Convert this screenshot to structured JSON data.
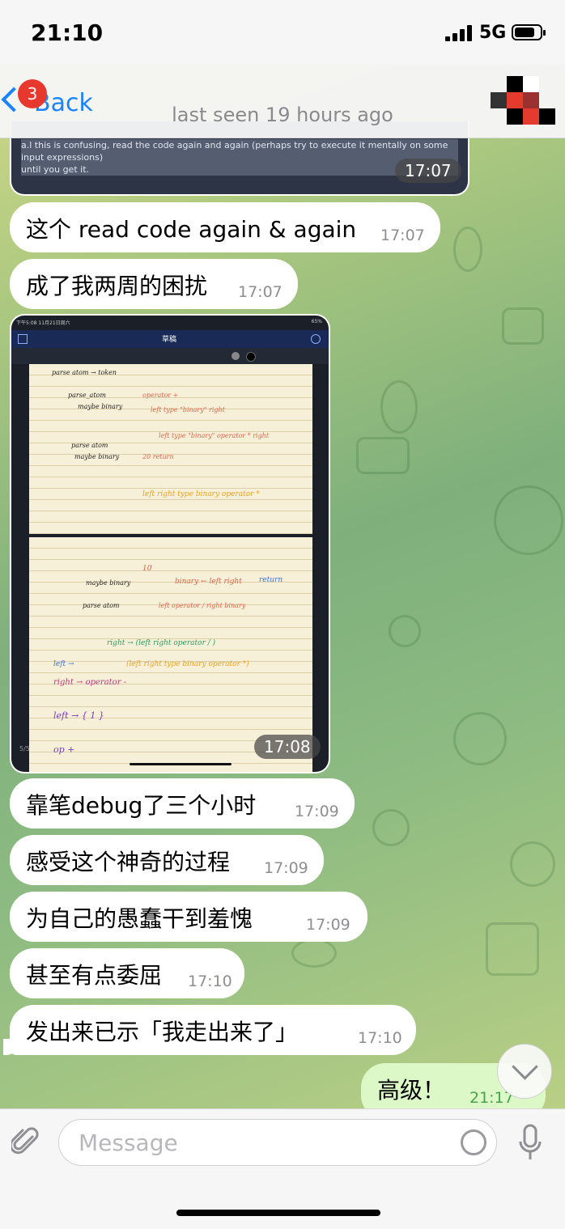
{
  "status_bar": {
    "time": "21:10",
    "network": "5G"
  },
  "header": {
    "back_label": "Back",
    "unread_count": "3",
    "subtitle": "last seen 19 hours ago"
  },
  "photo_message_1": {
    "caption_line1": "a.l this is confusing, read the code again and again (perhaps try to execute it mentally on some input expressions)",
    "caption_line2": "until you get it.",
    "time": "17:07"
  },
  "messages_a": [
    {
      "text": "这个 read code again & again",
      "time": "17:07"
    },
    {
      "text": "成了我两周的困扰",
      "time": "17:07"
    }
  ],
  "photo_message_2": {
    "time": "17:08",
    "tablet_status_left": "下午5:08  11月21日周六",
    "tablet_status_right": "65%",
    "tablet_title": "草稿",
    "page_indicator": "5/5"
  },
  "messages_b": [
    {
      "text": "靠笔debug了三个小时",
      "time": "17:09"
    },
    {
      "text": "感受这个神奇的过程",
      "time": "17:09"
    },
    {
      "text": "为自己的愚蠢干到羞愧",
      "time": "17:09"
    },
    {
      "text": "甚至有点委屈",
      "time": "17:10"
    },
    {
      "text": "发出来已示「我走出来了」",
      "time": "17:10"
    }
  ],
  "outgoing_message": {
    "text": "高级！",
    "time": "21:17"
  },
  "input_bar": {
    "placeholder": "Message"
  },
  "colors": {
    "accent": "#1a84ff",
    "badge": "#e8382e",
    "outgoing_bubble": "#dcf8c6"
  },
  "icons": [
    "back-chevron-icon",
    "paperclip-icon",
    "sticker-icon",
    "microphone-icon",
    "chevron-down-icon",
    "signal-icon",
    "battery-icon"
  ]
}
